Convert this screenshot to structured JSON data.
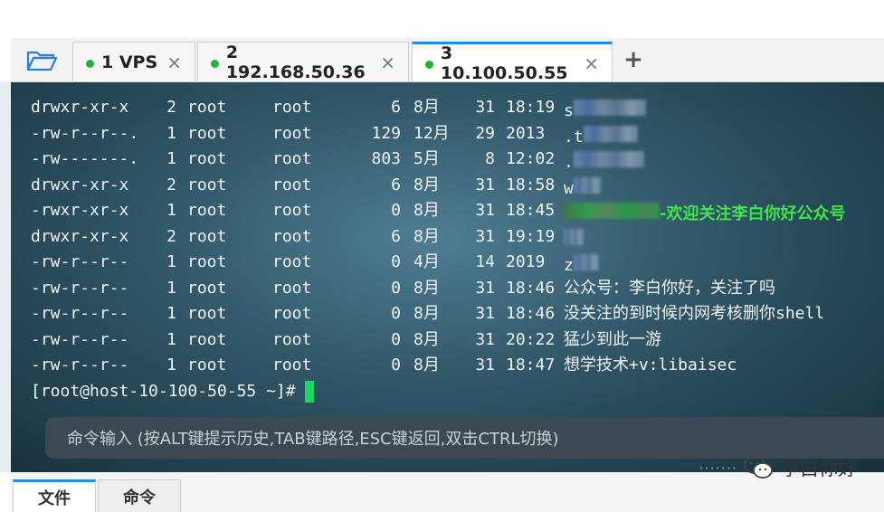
{
  "tabs": [
    {
      "label": "1 VPS",
      "status_color": "#22b33a",
      "active": false
    },
    {
      "label": "2 192.168.50.36",
      "status_color": "#22b33a",
      "active": false
    },
    {
      "label": "3 10.100.50.55",
      "status_color": "#22b33a",
      "active": true
    }
  ],
  "tab_close_glyph": "×",
  "add_tab_glyph": "+",
  "terminal": {
    "lines": [
      {
        "perm": "drwxr-xr-x",
        "links": "2",
        "owner": "root",
        "group": "root",
        "size": "6",
        "month": "8月",
        "day": "31",
        "time": "18:19",
        "name": "s"
      },
      {
        "perm": "-rw-r--r--.",
        "links": "1",
        "owner": "root",
        "group": "root",
        "size": "129",
        "month": "12月",
        "day": "29",
        "time": "2013",
        "name": ".t"
      },
      {
        "perm": "-rw-------.",
        "links": "1",
        "owner": "root",
        "group": "root",
        "size": "803",
        "month": "5月",
        "day": "8",
        "time": "12:02",
        "name": "."
      },
      {
        "perm": "drwxr-xr-x",
        "links": "2",
        "owner": "root",
        "group": "root",
        "size": "6",
        "month": "8月",
        "day": "31",
        "time": "18:58",
        "name": "w"
      },
      {
        "perm": "-rwxr-xr-x",
        "links": "1",
        "owner": "root",
        "group": "root",
        "size": "0",
        "month": "8月",
        "day": "31",
        "time": "18:45",
        "name": "-欢迎关注李白你好公众号"
      },
      {
        "perm": "drwxr-xr-x",
        "links": "2",
        "owner": "root",
        "group": "root",
        "size": "6",
        "month": "8月",
        "day": "31",
        "time": "19:19",
        "name": ""
      },
      {
        "perm": "-rw-r--r--",
        "links": "1",
        "owner": "root",
        "group": "root",
        "size": "0",
        "month": "4月",
        "day": "14",
        "time": "2019",
        "name": "z"
      },
      {
        "perm": "-rw-r--r--",
        "links": "1",
        "owner": "root",
        "group": "root",
        "size": "0",
        "month": "8月",
        "day": "31",
        "time": "18:46",
        "name": "公众号：李白你好，关注了吗"
      },
      {
        "perm": "-rw-r--r--",
        "links": "1",
        "owner": "root",
        "group": "root",
        "size": "0",
        "month": "8月",
        "day": "31",
        "time": "18:46",
        "name": "没关注的到时候内网考核删你shell"
      },
      {
        "perm": "-rw-r--r--",
        "links": "1",
        "owner": "root",
        "group": "root",
        "size": "0",
        "month": "8月",
        "day": "31",
        "time": "20:22",
        "name": "猛少到此一游"
      },
      {
        "perm": "-rw-r--r--",
        "links": "1",
        "owner": "root",
        "group": "root",
        "size": "0",
        "month": "8月",
        "day": "31",
        "time": "18:47",
        "name": "想学技术+v:libaisec"
      }
    ],
    "prompt": "[root@host-10-100-50-55 ~]#",
    "cursor_color": "#1ed760",
    "welcome_color": "#3ee64a"
  },
  "command_input": {
    "placeholder": "命令输入 (按ALT键提示历史,TAB键路径,ESC键返回,双击CTRL切换)"
  },
  "bottom_tabs": [
    {
      "label": "文件",
      "active": true
    },
    {
      "label": "命令",
      "active": false
    }
  ],
  "watermark": {
    "dots": "·······",
    "text": "李白你好",
    "icon": "wechat-icon"
  },
  "accent_color": "#1e8ee0"
}
